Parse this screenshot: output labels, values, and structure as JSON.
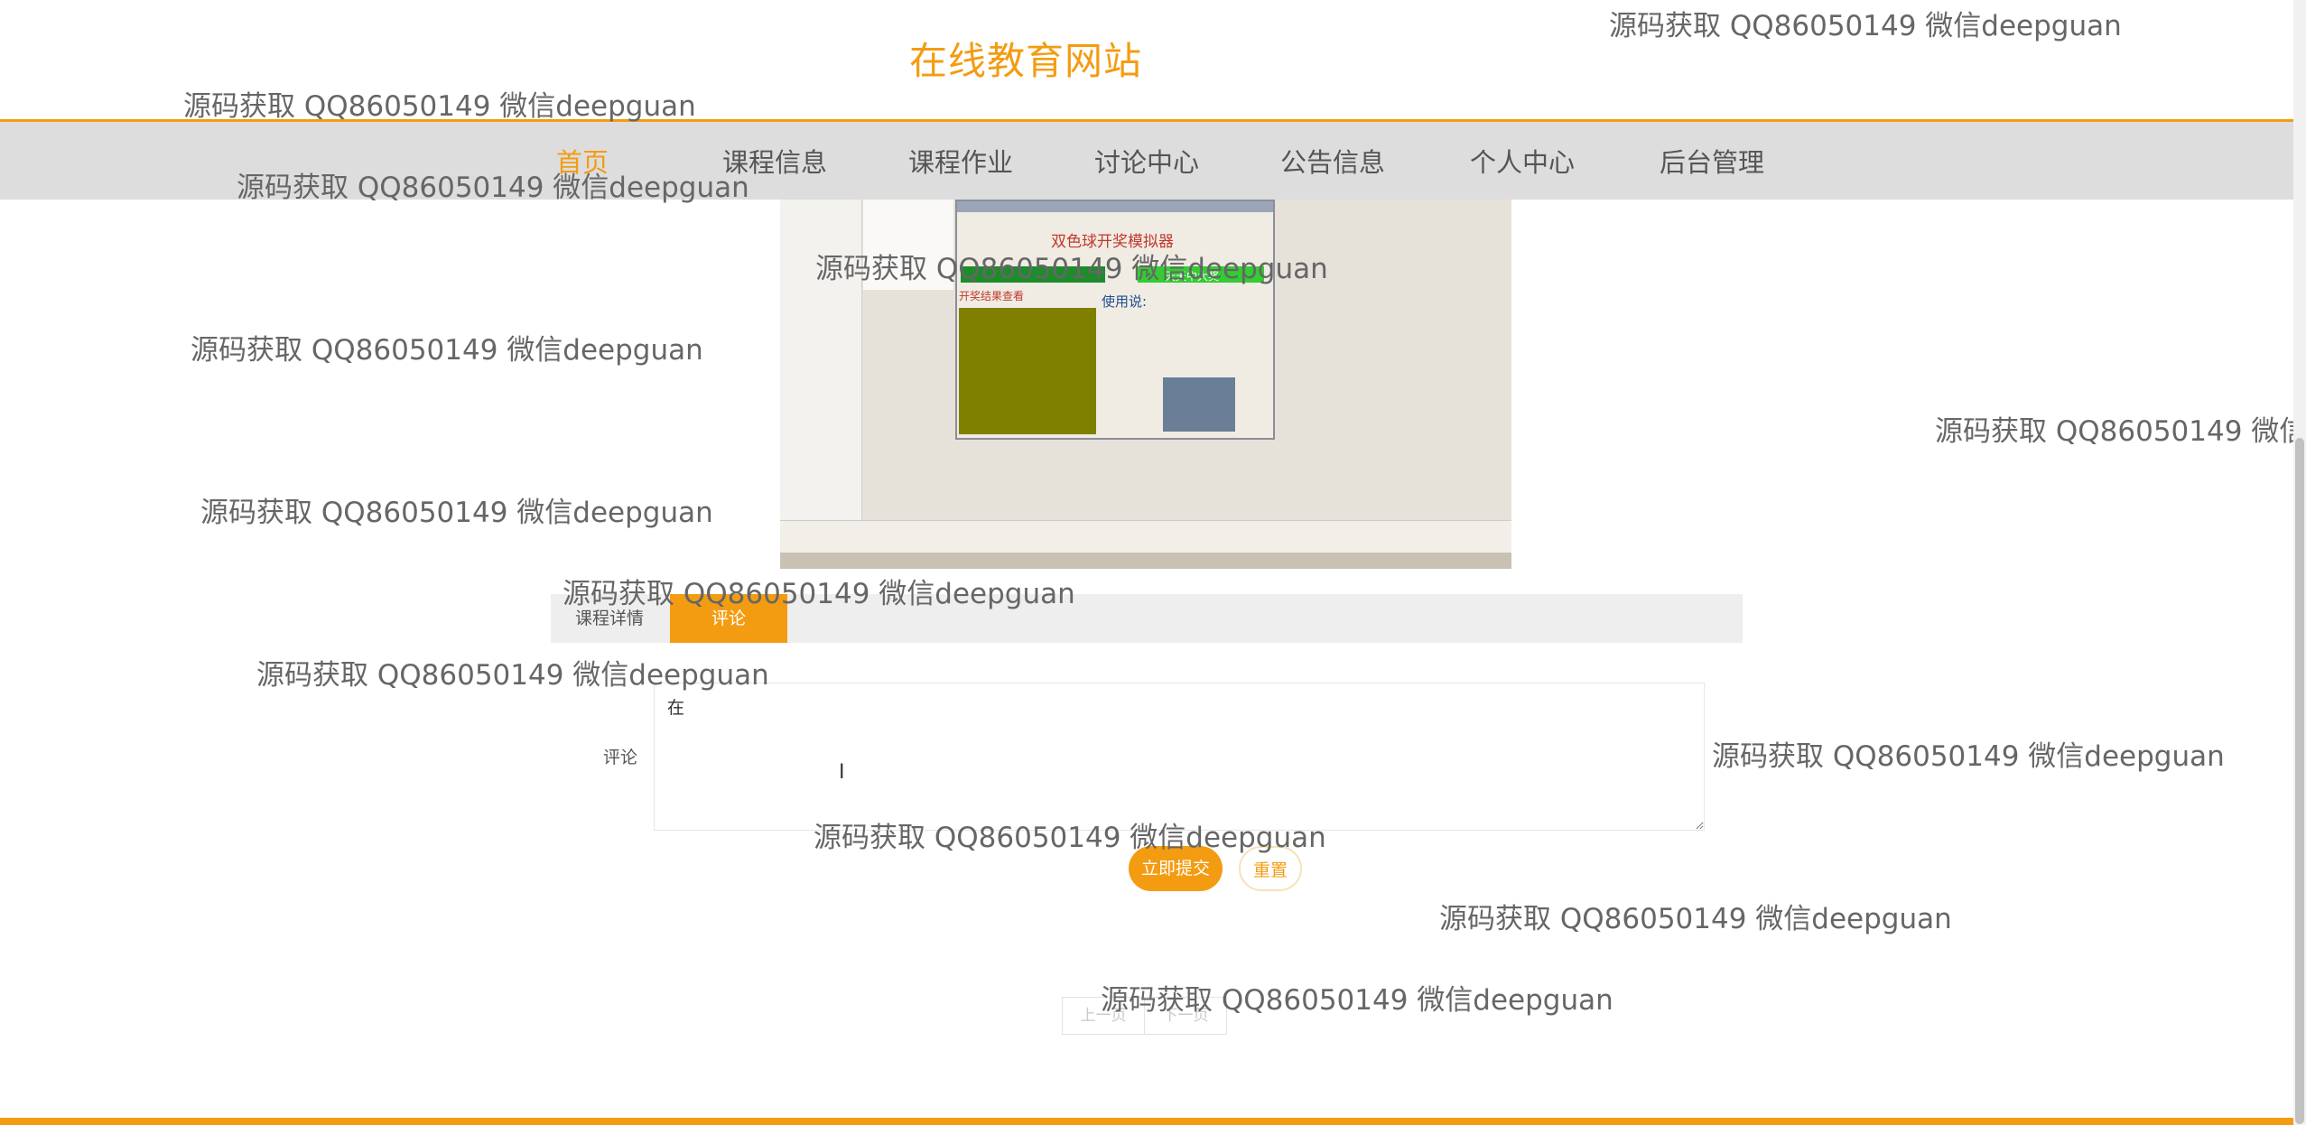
{
  "site": {
    "title": "在线教育网站"
  },
  "nav": {
    "items": [
      {
        "label": "首页"
      },
      {
        "label": "课程信息"
      },
      {
        "label": "课程作业"
      },
      {
        "label": "讨论中心"
      },
      {
        "label": "公告信息"
      },
      {
        "label": "个人中心"
      },
      {
        "label": "后台管理"
      }
    ],
    "active_index": 0
  },
  "course_image": {
    "window_title": "双色球开奖模拟器",
    "banner_text": "天天中大奖",
    "results_header": "开奖结果查看",
    "help_title": "使用说:"
  },
  "tabs": [
    {
      "label": "课程详情"
    },
    {
      "label": "评论"
    }
  ],
  "active_tab": 1,
  "comment": {
    "label": "评论",
    "value": "在"
  },
  "buttons": {
    "submit": "立即提交",
    "reset": "重置"
  },
  "pagination": {
    "prev": "上一页",
    "next": "下一页"
  },
  "watermark": {
    "text": "源码获取 QQ86050149 微信deepguan"
  },
  "colors": {
    "accent": "#f39c12",
    "nav_background": "#dddddd"
  }
}
